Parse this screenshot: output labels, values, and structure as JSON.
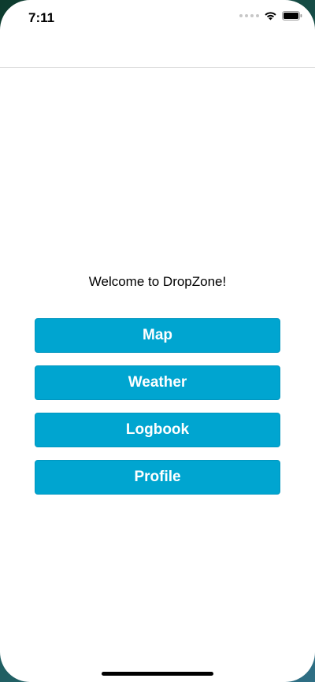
{
  "status_bar": {
    "time": "7:11",
    "icons": [
      "signal-icon",
      "wifi-icon",
      "battery-icon"
    ]
  },
  "main": {
    "welcome_text": "Welcome to DropZone!",
    "buttons": [
      {
        "label": "Map"
      },
      {
        "label": "Weather"
      },
      {
        "label": "Logbook"
      },
      {
        "label": "Profile"
      }
    ]
  },
  "colors": {
    "button_bg": "#00a5d0",
    "button_text": "#ffffff",
    "background": "#ffffff"
  }
}
